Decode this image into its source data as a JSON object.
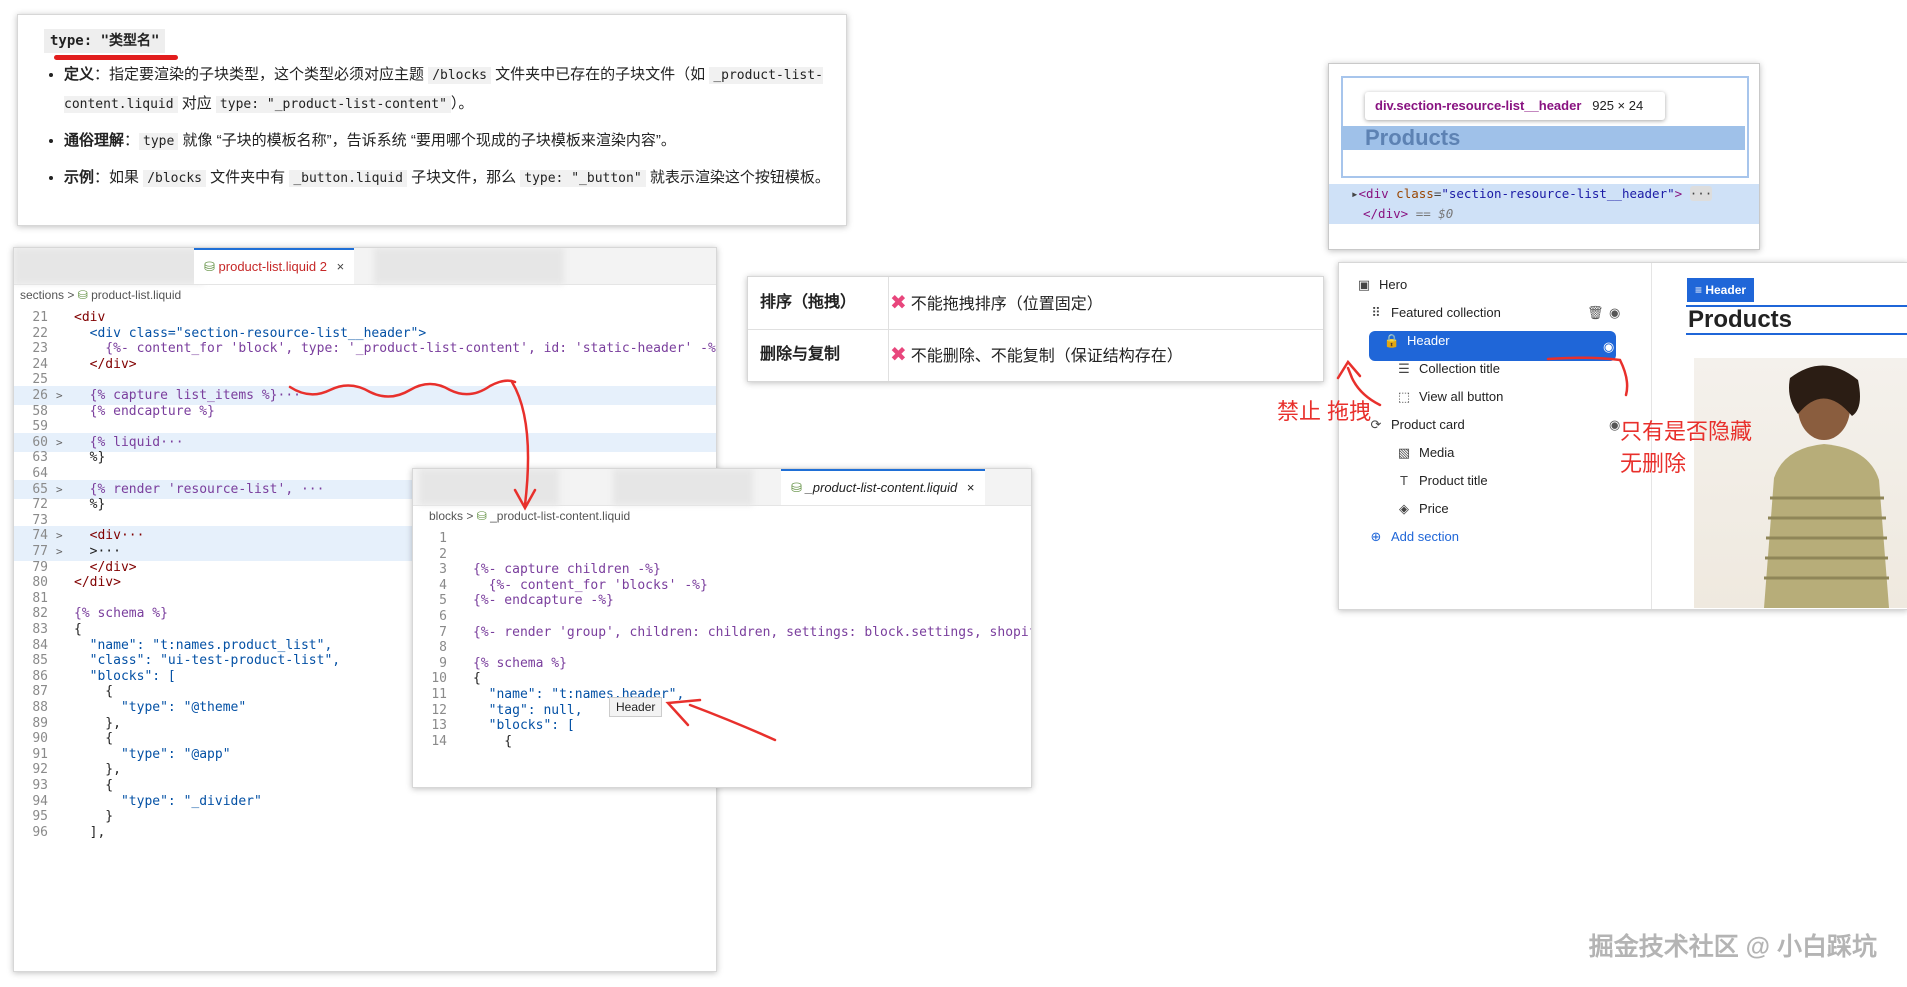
{
  "doc": {
    "heading": "type: \"类型名\"",
    "items": [
      {
        "label": "定义",
        "text_a": "：指定要渲染的子块类型，这个类型必须对应主题 ",
        "code_a": "/blocks",
        "text_b": " 文件夹中已存在的子块文件（如 ",
        "code_b": "_product-list-content.liquid",
        "text_c": " 对应 ",
        "code_c": "type: \"_product-list-content\"",
        "text_d": "）。"
      },
      {
        "label": "通俗理解",
        "text_a": "：",
        "code_a": "type",
        "text_b": " 就像 “子块的模板名称”，告诉系统 “要用哪个现成的子块模板来渲染内容”。"
      },
      {
        "label": "示例",
        "text_a": "：如果 ",
        "code_a": "/blocks",
        "text_b": " 文件夹中有 ",
        "code_b": "_button.liquid",
        "text_c": " 子块文件，那么 ",
        "code_c": "type: \"_button\"",
        "text_d": " 就表示渲染这个按钮模板。"
      }
    ]
  },
  "editor": {
    "tab_label": "product-list.liquid",
    "tab_badge": "2",
    "close": "×",
    "breadcrumb": [
      "sections",
      "product-list.liquid"
    ],
    "lines": [
      {
        "n": "21",
        "t": "<div",
        "fold": ""
      },
      {
        "n": "22",
        "t": "  <div class=\"section-resource-list__header\">",
        "fold": ""
      },
      {
        "n": "23",
        "t": "    {%- content_for 'block', type: '_product-list-content', id: 'static-header' -%}",
        "fold": ""
      },
      {
        "n": "24",
        "t": "  </div>",
        "fold": ""
      },
      {
        "n": "25",
        "t": "",
        "fold": ""
      },
      {
        "n": "26",
        "t": "  {% capture list_items %}···",
        "fold": ">",
        "hl": true
      },
      {
        "n": "58",
        "t": "  {% endcapture %}",
        "fold": ""
      },
      {
        "n": "59",
        "t": "",
        "fold": ""
      },
      {
        "n": "60",
        "t": "  {% liquid···",
        "fold": ">",
        "hl": true
      },
      {
        "n": "63",
        "t": "  %}",
        "fold": ""
      },
      {
        "n": "64",
        "t": "",
        "fold": ""
      },
      {
        "n": "65",
        "t": "  {% render 'resource-list', ···",
        "fold": ">",
        "hl": true
      },
      {
        "n": "72",
        "t": "  %}",
        "fold": ""
      },
      {
        "n": "73",
        "t": "",
        "fold": ""
      },
      {
        "n": "74",
        "t": "  <div···",
        "fold": ">",
        "hl": true
      },
      {
        "n": "77",
        "t": "  >···",
        "fold": ">",
        "hl": true
      },
      {
        "n": "79",
        "t": "  </div>",
        "fold": ""
      },
      {
        "n": "80",
        "t": "</div>",
        "fold": ""
      },
      {
        "n": "81",
        "t": "",
        "fold": ""
      },
      {
        "n": "82",
        "t": "{% schema %}",
        "fold": ""
      },
      {
        "n": "83",
        "t": "{",
        "fold": ""
      },
      {
        "n": "84",
        "t": "  \"name\": \"t:names.product_list\",",
        "fold": ""
      },
      {
        "n": "85",
        "t": "  \"class\": \"ui-test-product-list\",",
        "fold": ""
      },
      {
        "n": "86",
        "t": "  \"blocks\": [",
        "fold": ""
      },
      {
        "n": "87",
        "t": "    {",
        "fold": ""
      },
      {
        "n": "88",
        "t": "      \"type\": \"@theme\"",
        "fold": ""
      },
      {
        "n": "89",
        "t": "    },",
        "fold": ""
      },
      {
        "n": "90",
        "t": "    {",
        "fold": ""
      },
      {
        "n": "91",
        "t": "      \"type\": \"@app\"",
        "fold": ""
      },
      {
        "n": "92",
        "t": "    },",
        "fold": ""
      },
      {
        "n": "93",
        "t": "    {",
        "fold": ""
      },
      {
        "n": "94",
        "t": "      \"type\": \"_divider\"",
        "fold": ""
      },
      {
        "n": "95",
        "t": "    }",
        "fold": ""
      },
      {
        "n": "96",
        "t": "  ],",
        "fold": ""
      }
    ]
  },
  "popup": {
    "tab_label": "_product-list-content.liquid",
    "close": "×",
    "breadcrumb": [
      "blocks",
      "_product-list-content.liquid"
    ],
    "lines": [
      {
        "n": "1",
        "t": ""
      },
      {
        "n": "2",
        "t": ""
      },
      {
        "n": "3",
        "t": "{%- capture children -%}"
      },
      {
        "n": "4",
        "t": "  {%- content_for 'blocks' -%}"
      },
      {
        "n": "5",
        "t": "{%- endcapture -%}"
      },
      {
        "n": "6",
        "t": ""
      },
      {
        "n": "7",
        "t": "{%- render 'group', children: children, settings: block.settings, shopif"
      },
      {
        "n": "8",
        "t": ""
      },
      {
        "n": "9",
        "t": "{% schema %}"
      },
      {
        "n": "10",
        "t": "{"
      },
      {
        "n": "11",
        "t": "  \"name\": \"t:names.header\","
      },
      {
        "n": "12",
        "t": "  \"tag\": null,"
      },
      {
        "n": "13",
        "t": "  \"blocks\": ["
      },
      {
        "n": "14",
        "t": "    {"
      }
    ],
    "hover": "Header"
  },
  "table": {
    "rows": [
      {
        "label": "排序（拖拽）",
        "value": "不能拖拽排序（位置固定）"
      },
      {
        "label": "删除与复制",
        "value": "不能删除、不能复制（保证结构存在）"
      }
    ],
    "mark": "✖"
  },
  "devtools": {
    "tooltip_class": "div.section-resource-list__header",
    "tooltip_size": "925 × 24",
    "preview_text": "Products",
    "elem_line1_tag": "<div ",
    "elem_line1_attr": "class",
    "elem_line1_val": "\"section-resource-list__header\"",
    "elem_line1_end": ">",
    "elem_line2": "</div>",
    "elem_line2_eq": "== $0"
  },
  "tree": {
    "items": [
      {
        "label": "Hero",
        "icon": "image-icon"
      },
      {
        "label": "Featured collection",
        "icon": "drag-icon"
      },
      {
        "label": "Header",
        "icon": "lock-icon"
      },
      {
        "label": "Collection title",
        "icon": "text-icon"
      },
      {
        "label": "View all button",
        "icon": "button-icon"
      },
      {
        "label": "Product card",
        "icon": "refresh-icon"
      },
      {
        "label": "Media",
        "icon": "media-icon"
      },
      {
        "label": "Product title",
        "icon": "title-icon"
      },
      {
        "label": "Price",
        "icon": "price-icon"
      },
      {
        "label": "Add section",
        "icon": "plus-circle-icon"
      }
    ],
    "preview_tag": "Header",
    "preview_title": "Products"
  },
  "annotations": {
    "no_drag": "禁止 拖拽",
    "hide_only_1": "只有是否隐藏",
    "hide_only_2": "无删除"
  },
  "watermark": "掘金技术社区 @ 小白踩坑",
  "colors": {
    "accent": "#1f66d8",
    "annotation": "#e8302c",
    "x_mark": "#e8467c"
  }
}
